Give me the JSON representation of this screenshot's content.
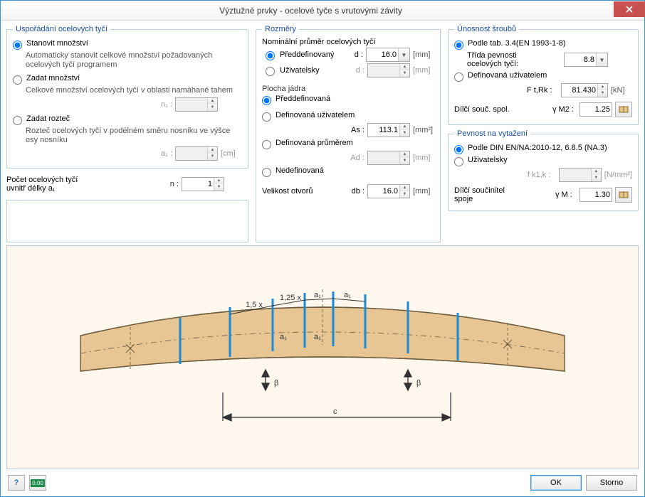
{
  "window": {
    "title": "Výztužné prvky - ocelové tyče s vrutovými závity"
  },
  "arrangement": {
    "legend": "Uspořádání ocelových tyčí",
    "opt_determine_label": "Stanovit množství",
    "opt_determine_desc": "Automaticky stanovit celkové množství požadovaných ocelových tyčí programem",
    "opt_enter_qty_label": "Zadat množství",
    "opt_enter_qty_desc": "Celkové množství ocelových tyčí v oblasti namáhané tahem",
    "n1_label": "n₁ :",
    "opt_spacing_label": "Zadat rozteč",
    "opt_spacing_desc": "Rozteč ocelových tyčí v podélném směru nosníku ve výšce osy nosníku",
    "a1_label": "a₁ :",
    "a1_unit": "[cm]",
    "count_label_1": "Počet ocelových tyčí",
    "count_label_2": "uvnitř délky a₁",
    "n_label": "n :",
    "n_value": "1"
  },
  "dimensions": {
    "legend": "Rozměry",
    "nominal_title": "Nominální průměr ocelových tyčí",
    "predef_label": "Předdefinovaný",
    "user_label": "Uživatelsky",
    "d_label": "d :",
    "d_value": "16.0",
    "d_unit": "[mm]",
    "core_title": "Plocha jádra",
    "core_predef": "Předdefinovaná",
    "core_user": "Definovaná uživatelem",
    "As_label": "As :",
    "As_value": "113.1",
    "As_unit": "[mm²]",
    "core_diam": "Definovaná průměrem",
    "Ad_label": "Ad :",
    "Ad_unit": "[mm]",
    "core_undef": "Nedefinovaná",
    "hole_label": "Velikost otvorů",
    "db_label": "db :",
    "db_value": "16.0",
    "db_unit": "[mm]"
  },
  "bolt": {
    "legend": "Únosnost šroubů",
    "opt_table": "Podle tab. 3.4(EN 1993-1-8)",
    "class_label": "Třída pevnosti ocelových tyčí:",
    "class_value": "8.8",
    "opt_user": "Definovaná uživatelem",
    "Ft_label": "F t,Rk :",
    "Ft_value": "81.430",
    "Ft_unit": "[kN]",
    "partial_label": "Dílčí souč. spol.",
    "gamma_m2": "γ M2 :",
    "gamma_m2_value": "1.25"
  },
  "pullout": {
    "legend": "Pevnost na vytažení",
    "opt_din": "Podle DIN EN/NA:2010-12, 6.8.5 (NA.3)",
    "opt_user": "Uživatelsky",
    "fk_label": "f k1,k :",
    "fk_unit": "[N/mm²]",
    "partial_label": "Dílčí součinitel spoje",
    "gamma_m": "γ M :",
    "gamma_m_value": "1.30"
  },
  "diagram": {
    "a1": "a₁",
    "mult15": "1,5 x",
    "mult125": "1,25 x",
    "beta": "β",
    "c": "c"
  },
  "footer": {
    "ok": "OK",
    "cancel": "Storno",
    "help_icon": "?",
    "units_icon": "0.00"
  }
}
